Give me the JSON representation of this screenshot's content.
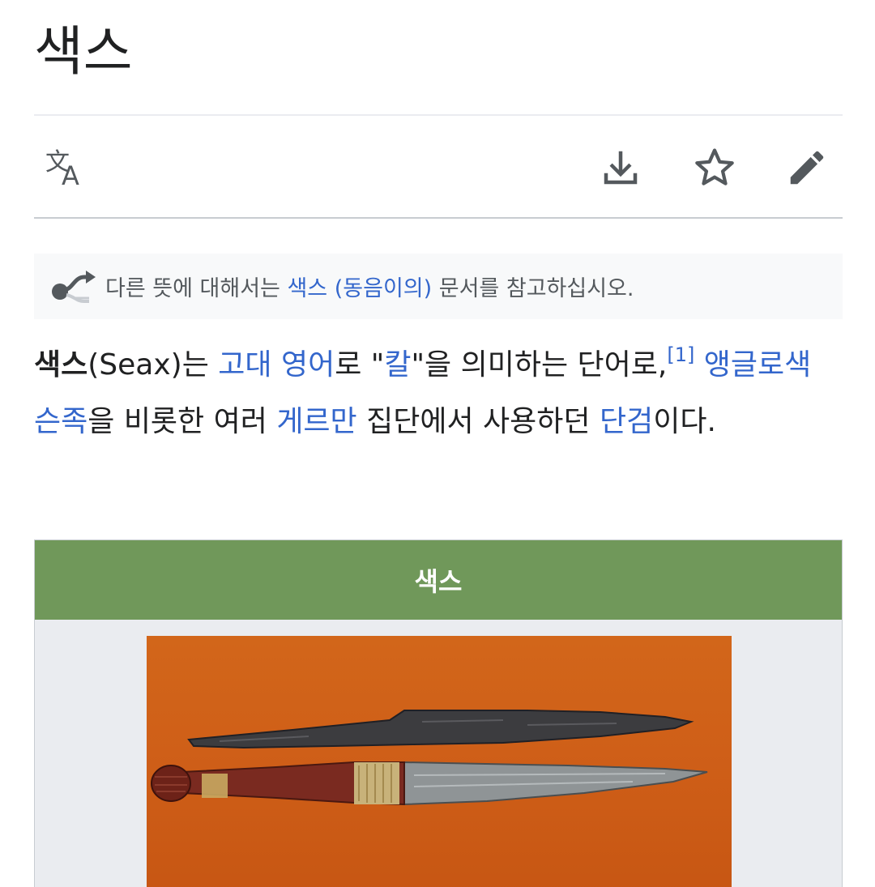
{
  "page": {
    "title": "색스"
  },
  "actions": {
    "language_icon": "translate-icon",
    "download_icon": "download-icon",
    "watch_icon": "star-icon",
    "edit_icon": "pencil-icon"
  },
  "hatnote": {
    "icon": "disambiguation-icon",
    "prefix": "다른 뜻에 대해서는 ",
    "link": "색스 (동음이의)",
    "suffix": " 문서를 참고하십시오."
  },
  "lead": {
    "term": "색스",
    "term_latin": "(Seax)는 ",
    "link_old_english": "고대 영어",
    "text1": "로 \"",
    "link_knife": "칼",
    "text2": "\"을 의미하는 단어로,",
    "ref": "[1]",
    "space1": " ",
    "link_anglo_saxons": "앵글로색슨족",
    "text3": "을 비롯한 여러 ",
    "link_germanic": "게르만",
    "text4": " 집단에서 사용하던 ",
    "link_dagger": "단검",
    "text5": "이다."
  },
  "infobox": {
    "title": "색스",
    "header_color": "#70985a",
    "image_subject": "two-seax-blades"
  },
  "colors": {
    "link": "#3366cc",
    "text": "#202122",
    "muted": "#54595d",
    "hatnote_bg": "#f8f9fa"
  }
}
